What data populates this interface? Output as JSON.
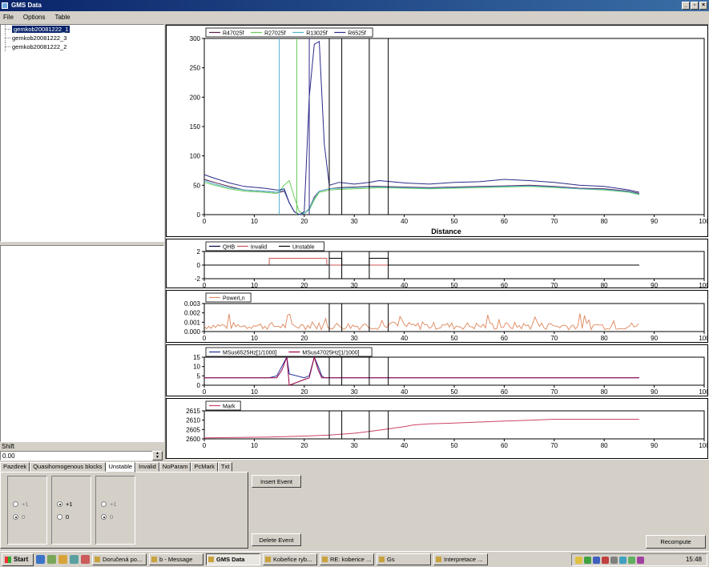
{
  "window": {
    "title": "GMS Data"
  },
  "menu": [
    "File",
    "Options",
    "Table"
  ],
  "tree": [
    {
      "label": "gemkob20081222_1",
      "selected": true
    },
    {
      "label": "gemkob20081222_3",
      "selected": false
    },
    {
      "label": "gemkob20081222_2",
      "selected": false
    }
  ],
  "shift": {
    "label": "Shift",
    "value": "0.00"
  },
  "tabs": [
    "Pazdirek",
    "Quasihomogenous blocks",
    "Unstable",
    "Invalid",
    "NoParam",
    "PcMark",
    "Txt"
  ],
  "active_tab": "Unstable",
  "groups": [
    {
      "options": [
        "+1",
        "0"
      ],
      "selected": "0",
      "enabled": false
    },
    {
      "options": [
        "+1",
        "0"
      ],
      "selected": "+1",
      "enabled": true
    },
    {
      "options": [
        "+1",
        "0"
      ],
      "selected": "0",
      "enabled": false
    }
  ],
  "buttons": {
    "insert": "Insert Event",
    "delete": "Delete Event",
    "recompute": "Recompute"
  },
  "taskbar": {
    "start": "Start",
    "tasks": [
      "Doručená po...",
      "b - Message",
      "GMS Data",
      "Kobeřice ryb...",
      "RE: koberice ...",
      "Gs",
      "Interpretace ..."
    ],
    "active": "GMS Data",
    "clock": "15:48"
  },
  "colors": {
    "R47025f": "#5b1a4a",
    "R27025f": "#66cc55",
    "R13025f": "#4fb0d0",
    "R6525f": "#2a2a8a",
    "QHB": "#00003c",
    "Invalid": "#cc5555",
    "Unstable": "#000000",
    "PowerLn": "#e0906a",
    "MSus6525": "#223399",
    "MSus47025": "#990044",
    "Mark": "#cc4466"
  },
  "chart_data": [
    {
      "type": "line",
      "xlabel": "Distance",
      "xlim": [
        0,
        100
      ],
      "ylim": [
        0,
        300
      ],
      "xticks": [
        0,
        10,
        20,
        30,
        40,
        50,
        60,
        70,
        80,
        90,
        100
      ],
      "yticks": [
        0,
        50,
        100,
        150,
        200,
        250,
        300
      ],
      "legend": "top-left",
      "events": [
        15,
        18.5,
        21,
        25,
        27.5,
        33,
        36.8
      ],
      "x": [
        0,
        2,
        5,
        8,
        12,
        14.5,
        15,
        16,
        17,
        18,
        19,
        20,
        21,
        22,
        23,
        24,
        25,
        27,
        30,
        33,
        35,
        40,
        45,
        50,
        55,
        60,
        65,
        70,
        75,
        80,
        85,
        87
      ],
      "series": [
        {
          "name": "R47025f",
          "values": [
            60,
            55,
            48,
            42,
            40,
            38,
            38,
            40,
            20,
            5,
            0,
            2,
            10,
            30,
            40,
            42,
            44,
            46,
            47,
            48,
            48,
            47,
            46,
            47,
            48,
            49,
            50,
            48,
            45,
            44,
            40,
            36
          ]
        },
        {
          "name": "R27025f",
          "values": [
            55,
            50,
            44,
            40,
            38,
            36,
            40,
            50,
            58,
            30,
            5,
            2,
            8,
            25,
            38,
            40,
            42,
            43,
            44,
            45,
            46,
            45,
            44,
            45,
            46,
            47,
            48,
            46,
            44,
            42,
            38,
            34
          ]
        },
        {
          "name": "R13025f",
          "values": [
            58,
            52,
            46,
            42,
            40,
            38,
            40,
            42,
            20,
            5,
            0,
            2,
            10,
            28,
            40,
            42,
            44,
            45,
            46,
            47,
            47,
            46,
            45,
            46,
            47,
            48,
            49,
            47,
            44,
            43,
            39,
            35
          ]
        },
        {
          "name": "R6525f",
          "values": [
            68,
            62,
            54,
            48,
            45,
            42,
            42,
            44,
            20,
            5,
            0,
            5,
            200,
            290,
            295,
            120,
            50,
            55,
            52,
            55,
            58,
            54,
            52,
            55,
            56,
            60,
            58,
            55,
            50,
            48,
            42,
            38
          ]
        }
      ]
    },
    {
      "type": "line",
      "xlim": [
        0,
        100
      ],
      "ylim": [
        -2,
        2
      ],
      "xticks": [
        0,
        10,
        20,
        30,
        40,
        50,
        60,
        70,
        80,
        90,
        100
      ],
      "yticks": [
        -2,
        0,
        2
      ],
      "legend": "top-left",
      "events": [
        15,
        18.5,
        21,
        25,
        27.5,
        33,
        36.8
      ],
      "series": [
        {
          "name": "QHB",
          "x": [
            0,
            87
          ],
          "values": [
            0,
            0
          ]
        },
        {
          "name": "Invalid",
          "x": [
            0,
            13,
            13,
            24.5,
            24.5,
            87
          ],
          "values": [
            0,
            0,
            1,
            1,
            0,
            0
          ]
        },
        {
          "name": "Unstable",
          "x": [
            0,
            25,
            25,
            27.5,
            27.5,
            33,
            33,
            36.8,
            36.8,
            87
          ],
          "values": [
            0,
            0,
            1,
            1,
            0,
            0,
            1,
            1,
            0,
            0
          ]
        }
      ]
    },
    {
      "type": "line",
      "xlim": [
        0,
        100
      ],
      "ylim": [
        0,
        0.003
      ],
      "xticks": [
        0,
        10,
        20,
        30,
        40,
        50,
        60,
        70,
        80,
        90,
        100
      ],
      "yticks": [
        0,
        0.001,
        0.002,
        0.003
      ],
      "legend": "top-left",
      "events": [
        15,
        18.5,
        21,
        25,
        27.5,
        33,
        36.8
      ],
      "series": [
        {
          "name": "PowerLn",
          "x": [
            0,
            87
          ],
          "values": [
            0.0005,
            0.0005
          ],
          "note_range": [
            0.0002,
            0.0012
          ]
        }
      ]
    },
    {
      "type": "line",
      "xlim": [
        0,
        100
      ],
      "ylim": [
        0,
        15
      ],
      "xticks": [
        0,
        10,
        20,
        30,
        40,
        50,
        60,
        70,
        80,
        90,
        100
      ],
      "yticks": [
        0,
        5,
        10,
        15
      ],
      "legend": "top-left",
      "events": [
        15,
        18.5,
        21,
        25,
        27.5,
        33,
        36.8
      ],
      "series": [
        {
          "name": "MSus6525Hz[1/1000]",
          "x": [
            0,
            13,
            14.5,
            15.5,
            16.5,
            17,
            20,
            21,
            22,
            22.8,
            23.5,
            24,
            87
          ],
          "values": [
            4,
            4,
            5,
            10,
            15,
            6,
            4,
            5,
            15,
            10,
            5,
            4,
            4
          ]
        },
        {
          "name": "MSus47025Hz[1/1000]",
          "x": [
            0,
            13,
            14.5,
            15.5,
            16.5,
            17,
            20,
            21,
            22,
            22.8,
            23.5,
            24,
            87
          ],
          "values": [
            4,
            4,
            4,
            8,
            15,
            0,
            3,
            4,
            15,
            8,
            4,
            4,
            4
          ]
        }
      ]
    },
    {
      "type": "line",
      "xlim": [
        0,
        100
      ],
      "ylim": [
        2600,
        2615
      ],
      "xticks": [
        0,
        10,
        20,
        30,
        40,
        50,
        60,
        70,
        80,
        90,
        100
      ],
      "yticks": [
        2600,
        2605,
        2610,
        2615
      ],
      "legend": "top-left",
      "events": [
        15,
        18.5,
        21,
        25,
        27.5,
        33,
        36.8
      ],
      "series": [
        {
          "name": "Mark",
          "x": [
            0,
            13,
            20,
            25,
            30,
            33,
            36,
            40,
            42,
            45,
            50,
            55,
            60,
            65,
            70,
            75,
            80,
            87
          ],
          "values": [
            2600.5,
            2601,
            2601.5,
            2602,
            2603,
            2604,
            2605,
            2606.5,
            2607.5,
            2608,
            2608.5,
            2609,
            2609.5,
            2610,
            2610.5,
            2610.5,
            2610.5,
            2610.5
          ]
        }
      ]
    }
  ]
}
